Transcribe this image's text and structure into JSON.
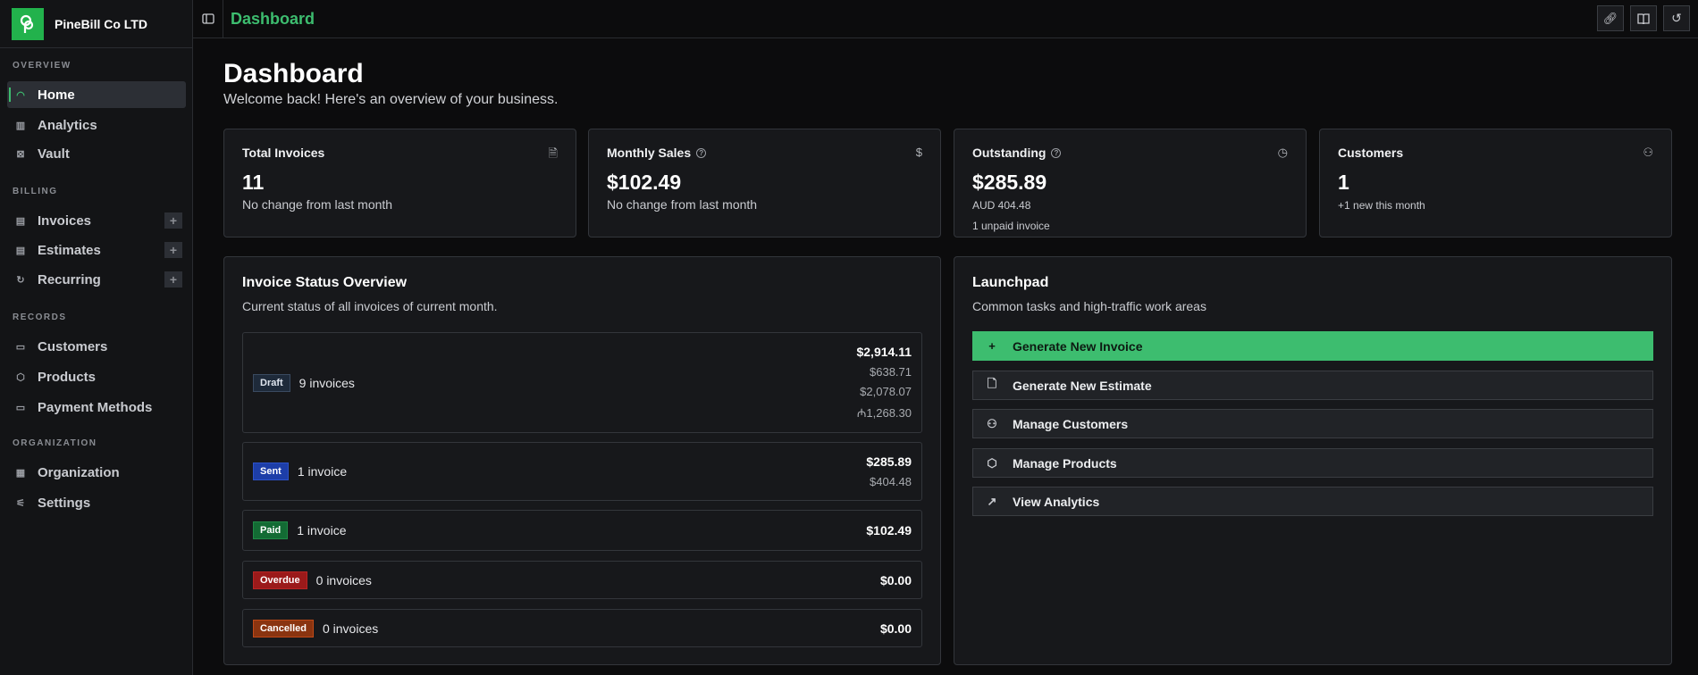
{
  "sidebar": {
    "org_name": "PineBill Co LTD",
    "sections": {
      "overview": "OVERVIEW",
      "billing": "BILLING",
      "records": "RECORDS",
      "organization": "ORGANIZATION"
    },
    "items": {
      "home": "Home",
      "analytics": "Analytics",
      "vault": "Vault",
      "invoices": "Invoices",
      "estimates": "Estimates",
      "recurring": "Recurring",
      "customers": "Customers",
      "products": "Products",
      "payment_methods": "Payment Methods",
      "organization": "Organization",
      "settings": "Settings"
    },
    "add_symbol": "+"
  },
  "header": {
    "breadcrumb": "Dashboard"
  },
  "page": {
    "title": "Dashboard",
    "subtitle": "Welcome back! Here's an overview of your business."
  },
  "stats": {
    "total_invoices": {
      "title": "Total Invoices",
      "value": "11",
      "sub": "No change from last month"
    },
    "monthly_sales": {
      "title": "Monthly Sales",
      "value": "$102.49",
      "sub": "No change from last month"
    },
    "outstanding": {
      "title": "Outstanding",
      "value": "$285.89",
      "sub1": "AUD 404.48",
      "sub2": "1 unpaid invoice"
    },
    "customers": {
      "title": "Customers",
      "value": "1",
      "sub": "+1 new this month"
    }
  },
  "invoice_status": {
    "title": "Invoice Status Overview",
    "subtitle": "Current status of all invoices of current month.",
    "rows": [
      {
        "status": "Draft",
        "count": "9 invoices",
        "total": "$2,914.11",
        "others": [
          "$638.71",
          "$2,078.07",
          "₼1,268.30"
        ]
      },
      {
        "status": "Sent",
        "count": "1 invoice",
        "total": "$285.89",
        "others": [
          "$404.48"
        ]
      },
      {
        "status": "Paid",
        "count": "1 invoice",
        "total": "$102.49",
        "others": []
      },
      {
        "status": "Overdue",
        "count": "0 invoices",
        "total": "$0.00",
        "others": []
      },
      {
        "status": "Cancelled",
        "count": "0 invoices",
        "total": "$0.00",
        "others": []
      }
    ]
  },
  "launchpad": {
    "title": "Launchpad",
    "subtitle": "Common tasks and high-traffic work areas",
    "actions": [
      "Generate New Invoice",
      "Generate New Estimate",
      "Manage Customers",
      "Manage Products",
      "View Analytics"
    ]
  },
  "colors": {
    "accent": "#3dbd6f",
    "draft": "#1e2a3a",
    "sent": "#1d3ea8",
    "paid": "#136b34",
    "overdue": "#9b1a1a",
    "cancelled": "#8a3410"
  }
}
